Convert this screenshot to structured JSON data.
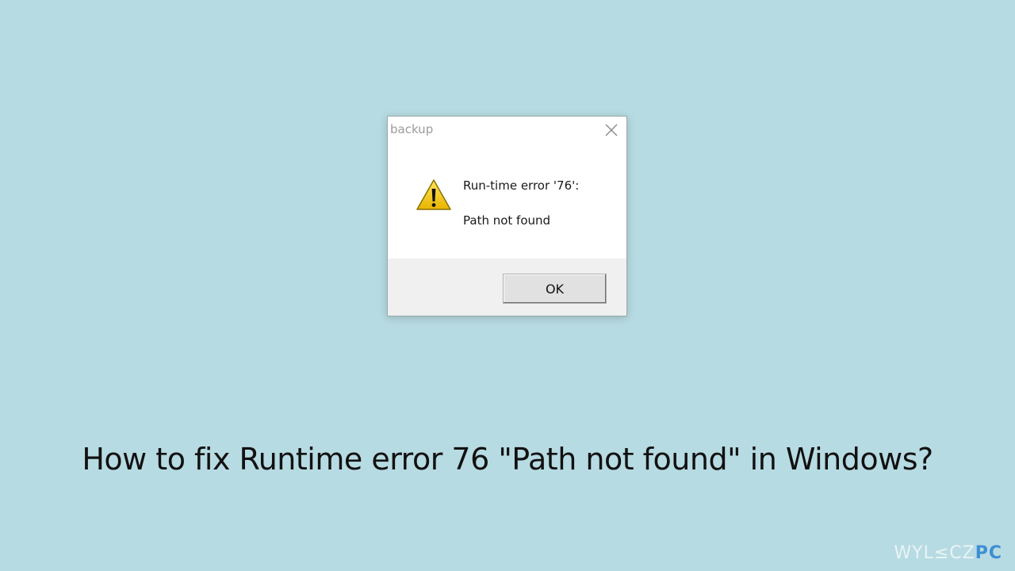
{
  "dialog": {
    "title": "backup",
    "close_icon": "close-icon",
    "warning_icon": "warning-icon",
    "error_line": "Run-time error '76':",
    "message_line": "Path not found",
    "ok_label": "OK"
  },
  "caption": "How to fix Runtime error 76 \"Path not found\" in Windows?",
  "watermark": {
    "main": "WYL≤CZ",
    "accent": "PC"
  },
  "colors": {
    "background": "#b7dbe2",
    "warning_yellow": "#f6d21e",
    "watermark_accent": "#3d8fd3"
  }
}
